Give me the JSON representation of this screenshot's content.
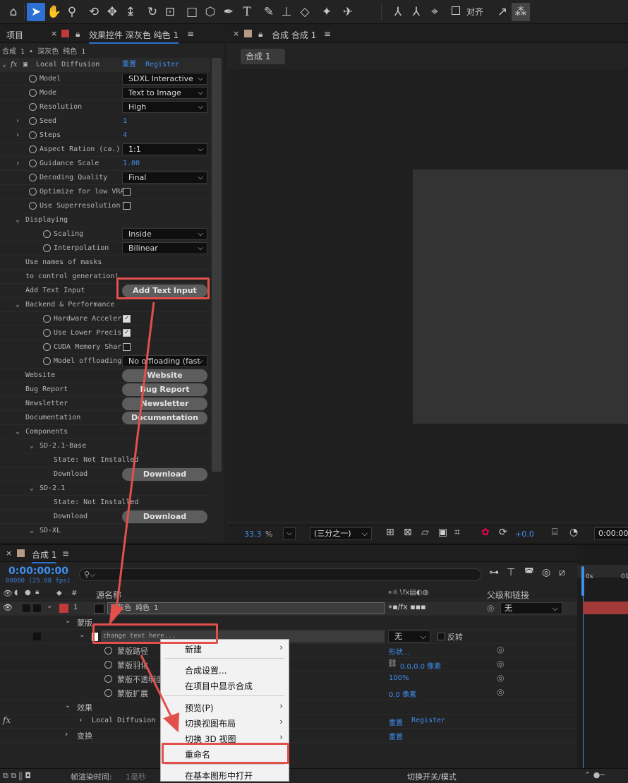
{
  "toolbar": {
    "align_label": "对齐"
  },
  "left_panel": {
    "tab_project": "项目",
    "tab_effects": "效果控件 深灰色 纯色 1",
    "breadcrumb": "合成 1 • 深灰色 纯色 1",
    "effect_name": "Local Diffusion",
    "reset": "重置",
    "register": "Register",
    "props": {
      "model": {
        "label": "Model",
        "value": "SDXL Interactive"
      },
      "mode": {
        "label": "Mode",
        "value": "Text to Image"
      },
      "resolution": {
        "label": "Resolution",
        "value": "High"
      },
      "seed": {
        "label": "Seed",
        "value": "1"
      },
      "steps": {
        "label": "Steps",
        "value": "4"
      },
      "aspect": {
        "label": "Aspect Ration (ca.)",
        "value": "1:1"
      },
      "guidance": {
        "label": "Guidance Scale",
        "value": "1.00"
      },
      "decoding": {
        "label": "Decoding Quality",
        "value": "Final"
      },
      "optimize": {
        "label": "Optimize for low VRA"
      },
      "superres": {
        "label": "Use Superresolution"
      },
      "displaying": {
        "label": "Displaying"
      },
      "scaling": {
        "label": "Scaling",
        "value": "Inside"
      },
      "interp": {
        "label": "Interpolation",
        "value": "Bilinear"
      },
      "names_masks": "Use names of masks",
      "control_gen": "to control generation!",
      "add_text": {
        "label": "Add Text Input",
        "button": "Add Text Input"
      },
      "backend": {
        "label": "Backend & Performance"
      },
      "hw": {
        "label": "Hardware Acceler"
      },
      "lower": {
        "label": "Use Lower Precis"
      },
      "cuda": {
        "label": "CUDA Memory Shar"
      },
      "offload": {
        "label": "Model offloading",
        "value": "No offloading (fast"
      },
      "website": {
        "label": "Website",
        "button": "Website"
      },
      "bug": {
        "label": "Bug Report",
        "button": "Bug Report"
      },
      "newsletter": {
        "label": "Newsletter",
        "button": "Newsletter"
      },
      "docs": {
        "label": "Documentation",
        "button": "Documentation"
      },
      "components": {
        "label": "Components"
      },
      "sd21base": {
        "label": "SD-2.1-Base",
        "state": "State: Not Installed",
        "download_label": "Download",
        "button": "Download"
      },
      "sd21": {
        "label": "SD-2.1",
        "state": "State: Not Installed",
        "download_label": "Download",
        "button": "Download"
      },
      "sdxl": {
        "label": "SD-XL"
      }
    }
  },
  "comp_panel": {
    "tab": "合成 合成 1",
    "subtab": "合成 1",
    "zoom": "33.3",
    "zoom_unit": "%",
    "resolution": "(三分之一)",
    "exposure": "+0.0",
    "timecode": "0:00:00:"
  },
  "timeline": {
    "tab": "合成 1",
    "timecode": "0:00:00:00",
    "frames": "00000 (25.00 fps)",
    "col_source": "源名称",
    "col_parent": "父级和链接",
    "layer_index": "1",
    "layer_name": "深灰色 纯色 1",
    "parent_value": "无",
    "masks": "蒙版",
    "mask_name": "change text here...",
    "mask_mode": "无",
    "invert": "反转",
    "mask_path": "蒙版路径",
    "mask_path_val": "形状...",
    "mask_feather": "蒙版羽化",
    "mask_feather_val": "0.0,0.0 像素",
    "mask_opacity": "蒙版不透明度",
    "mask_opacity_val": "100%",
    "mask_expand": "蒙版扩展",
    "mask_expand_val": "0.0 像素",
    "effects": "效果",
    "effect_name": "Local Diffusion",
    "effect_reset": "重置",
    "effect_register": "Register",
    "transform": "变换",
    "transform_reset": "重置",
    "render_time_label": "帧渲染时间:",
    "render_time": "1毫秒",
    "toggle_modes": "切换开关/模式",
    "ruler_0": "0s",
    "ruler_1": "01"
  },
  "context_menu": {
    "new": "新建",
    "comp_settings": "合成设置...",
    "show_in_project": "在项目中显示合成",
    "preview": "预览(P)",
    "switch_layout": "切换视图布局",
    "switch_3d": "切换 3D 视图",
    "rename": "重命名",
    "open_essential": "在基本图形中打开"
  },
  "colors": {
    "accent": "#2d6fd2",
    "highlight": "#e2504c",
    "link": "#3f8ef0",
    "layer_label": "#c0393b"
  }
}
